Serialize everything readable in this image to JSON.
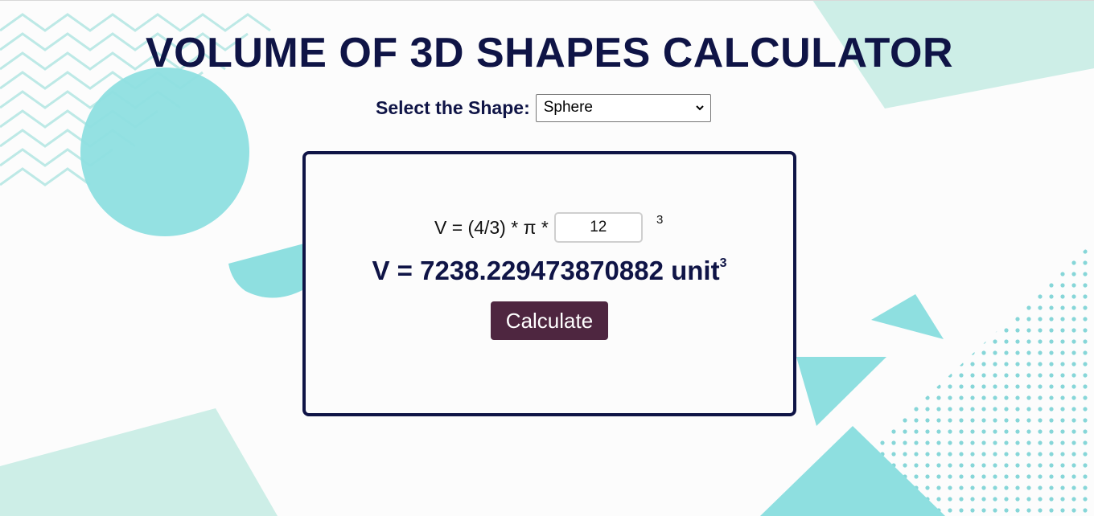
{
  "page": {
    "title": "VOLUME OF 3D SHAPES CALCULATOR"
  },
  "shape_selector": {
    "label": "Select the Shape:",
    "selected": "Sphere"
  },
  "calculator": {
    "formula_prefix": "V = (4/3) * π *",
    "radius_value": "12",
    "exponent": "3",
    "result_text": "V = 7238.229473870882 unit",
    "result_exponent": "3",
    "button_label": "Calculate"
  },
  "colors": {
    "title": "#0f1446",
    "card_border": "#0f1446",
    "button_bg": "#4e2640",
    "decor_teal": "#8edfe0",
    "decor_mint": "#cdeee7"
  }
}
